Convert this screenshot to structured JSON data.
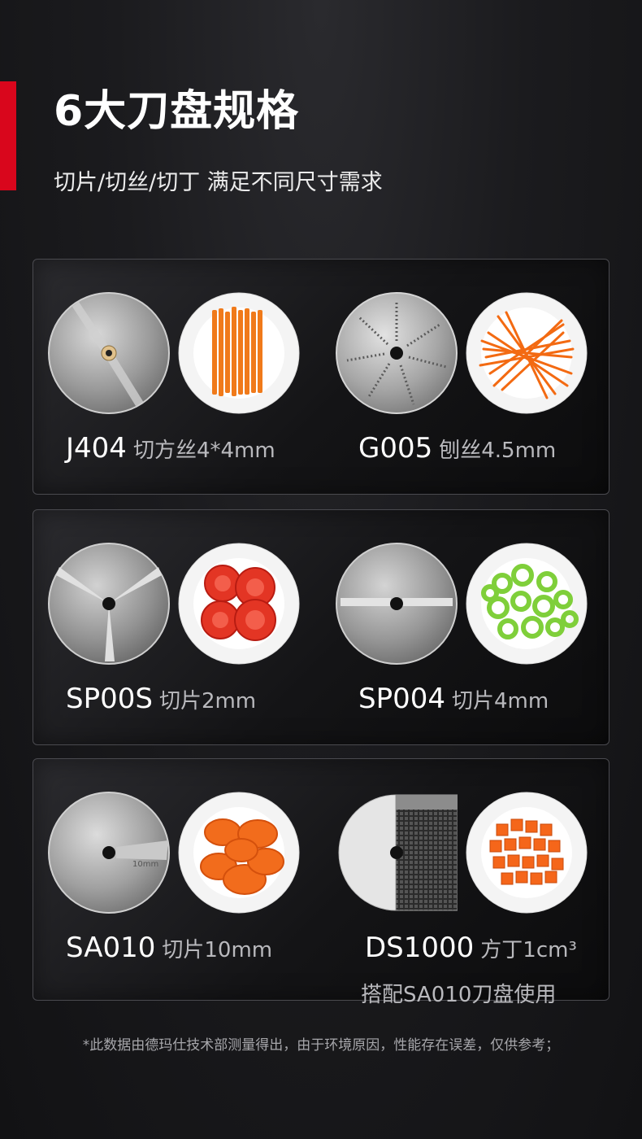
{
  "header": {
    "title": "6大刀盘规格",
    "subtitle": "切片/切丝/切丁 满足不同尺寸需求",
    "accent_color": "#d9061c"
  },
  "blades": [
    {
      "code": "J404",
      "desc": "切方丝4*4mm",
      "disc": "julienne-disc",
      "food": "carrot-square-strips"
    },
    {
      "code": "G005",
      "desc": "刨丝4.5mm",
      "disc": "grater-disc",
      "food": "carrot-shreds"
    },
    {
      "code": "SP00S",
      "desc": "切片2mm",
      "disc": "slicing-disc-2mm",
      "food": "tomato-slices"
    },
    {
      "code": "SP004",
      "desc": "切片4mm",
      "disc": "slicing-disc-4mm",
      "food": "green-pepper-rings"
    },
    {
      "code": "SA010",
      "desc": "切片10mm",
      "disc": "slicing-disc-10mm",
      "disc_marking": "10mm",
      "food": "carrot-slices"
    },
    {
      "code": "DS1000",
      "desc": "方丁1cm³",
      "note": "搭配SA010刀盘使用",
      "disc": "dicing-grid",
      "food": "carrot-cubes"
    }
  ],
  "footnote": "*此数据由德玛仕技术部测量得出，由于环境原因，性能存在误差，仅供参考；"
}
